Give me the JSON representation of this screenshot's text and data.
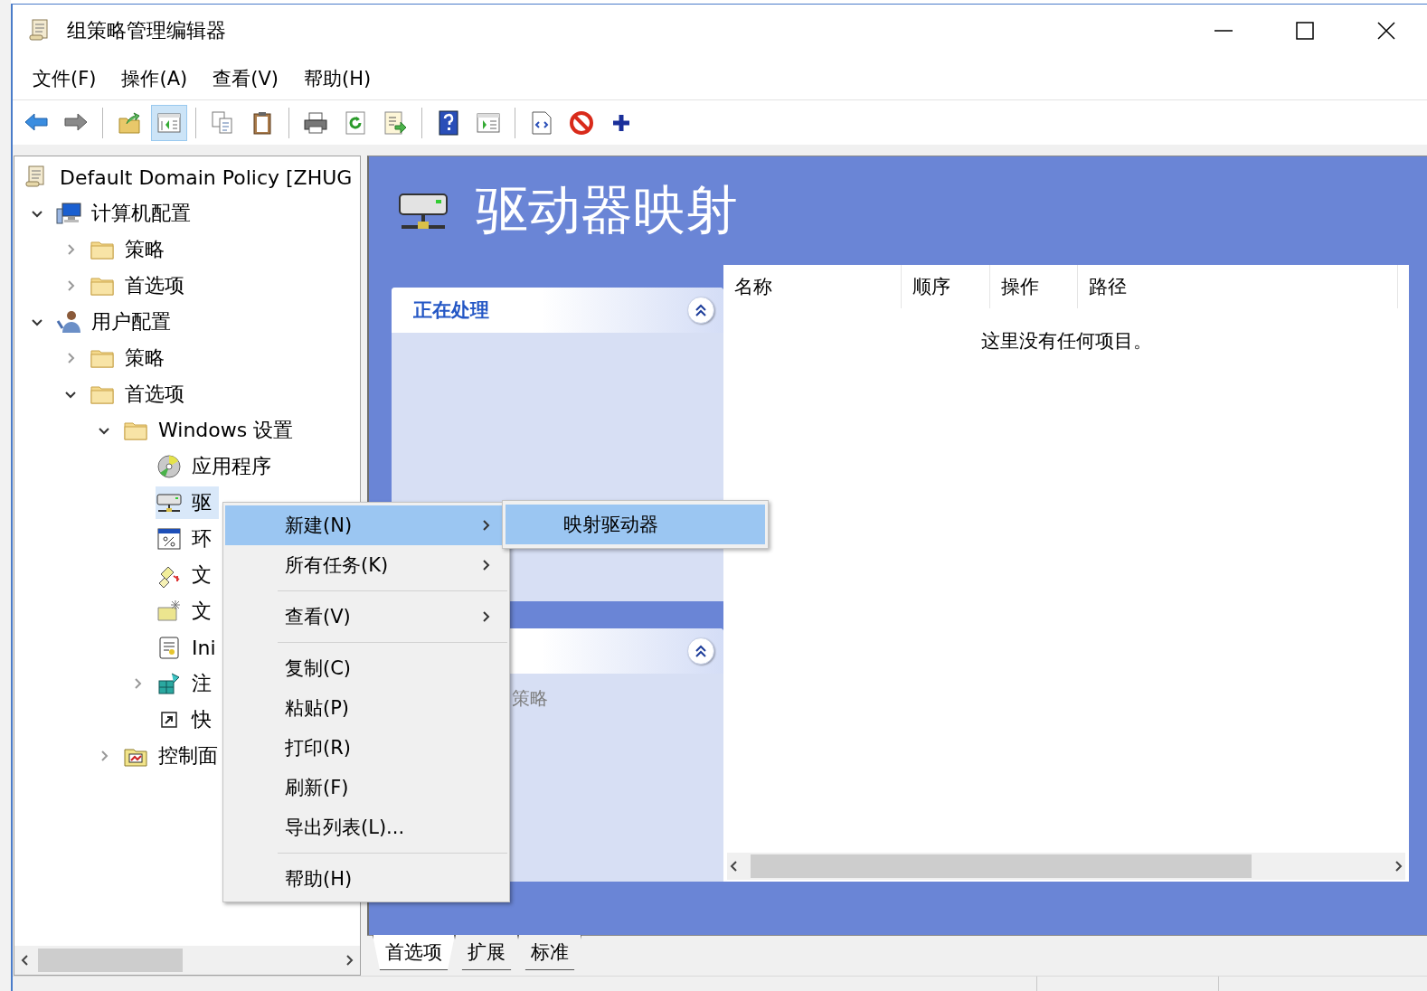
{
  "window": {
    "title": "组策略管理编辑器"
  },
  "menu_bar": [
    "文件(F)",
    "操作(A)",
    "查看(V)",
    "帮助(H)"
  ],
  "toolbar": [
    [
      {
        "pressed": false
      },
      {
        "pressed": false
      }
    ],
    [
      {
        "pressed": false
      },
      {
        "pressed": true
      }
    ],
    [
      {
        "pressed": false
      },
      {
        "pressed": false
      }
    ],
    [
      {
        "pressed": false
      },
      {
        "pressed": false
      },
      {
        "pressed": false
      }
    ],
    [
      {
        "pressed": false
      },
      {
        "pressed": false
      }
    ],
    [
      {
        "pressed": false
      },
      {
        "pressed": false
      },
      {
        "pressed": false
      }
    ]
  ],
  "tree": [
    {
      "label": "Default Domain Policy [ZHUG",
      "selected": false,
      "children": [
        {
          "label": "计算机配置",
          "expanded": true,
          "selected": false,
          "children": [
            {
              "label": "策略",
              "expanded": false,
              "selected": false
            },
            {
              "label": "首选项",
              "expanded": false,
              "selected": false
            }
          ]
        },
        {
          "label": "用户配置",
          "expanded": true,
          "selected": false,
          "children": [
            {
              "label": "策略",
              "expanded": false,
              "selected": false
            },
            {
              "label": "首选项",
              "expanded": true,
              "selected": false,
              "children": [
                {
                  "label": "Windows 设置",
                  "expanded": true,
                  "selected": false,
                  "children": [
                    {
                      "label": "应用程序",
                      "selected": false
                    },
                    {
                      "label": "驱",
                      "selected": true
                    },
                    {
                      "label": "环",
                      "selected": false
                    },
                    {
                      "label": "文",
                      "selected": false
                    },
                    {
                      "label": "文",
                      "selected": false
                    },
                    {
                      "label": "Ini",
                      "selected": false
                    },
                    {
                      "label": "注",
                      "expanded": false,
                      "selected": false
                    },
                    {
                      "label": "快",
                      "selected": false
                    }
                  ]
                },
                {
                  "label": "控制面",
                  "expanded": false,
                  "selected": false
                }
              ]
            }
          ]
        }
      ]
    }
  ],
  "detail": {
    "title": "驱动器映射",
    "task_panels": [
      {
        "title": "正在处理"
      },
      {
        "items": [
          "策略"
        ]
      }
    ],
    "list": {
      "columns": [
        "名称",
        "顺序",
        "操作",
        "路径"
      ],
      "empty_message": "这里没有任何项目。"
    }
  },
  "bottom_tabs": [
    {
      "label": "首选项",
      "selected": true
    },
    {
      "label": "扩展",
      "selected": false
    },
    {
      "label": "标准",
      "selected": false
    }
  ],
  "context_menu": [
    {
      "kind": "item",
      "label": "新建(N)",
      "submenu": true,
      "selected": true
    },
    {
      "kind": "item",
      "label": "所有任务(K)",
      "submenu": true,
      "selected": false
    },
    {
      "kind": "separator"
    },
    {
      "kind": "item",
      "label": "查看(V)",
      "submenu": true,
      "selected": false
    },
    {
      "kind": "separator"
    },
    {
      "kind": "item",
      "label": "复制(C)",
      "submenu": false,
      "selected": false
    },
    {
      "kind": "item",
      "label": "粘贴(P)",
      "submenu": false,
      "selected": false
    },
    {
      "kind": "item",
      "label": "打印(R)",
      "submenu": false,
      "selected": false
    },
    {
      "kind": "item",
      "label": "刷新(F)",
      "submenu": false,
      "selected": false
    },
    {
      "kind": "item",
      "label": "导出列表(L)...",
      "submenu": false,
      "selected": false
    },
    {
      "kind": "separator"
    },
    {
      "kind": "item",
      "label": "帮助(H)",
      "submenu": false,
      "selected": false
    }
  ],
  "submenu": [
    {
      "label": "映射驱动器",
      "selected": true
    }
  ]
}
